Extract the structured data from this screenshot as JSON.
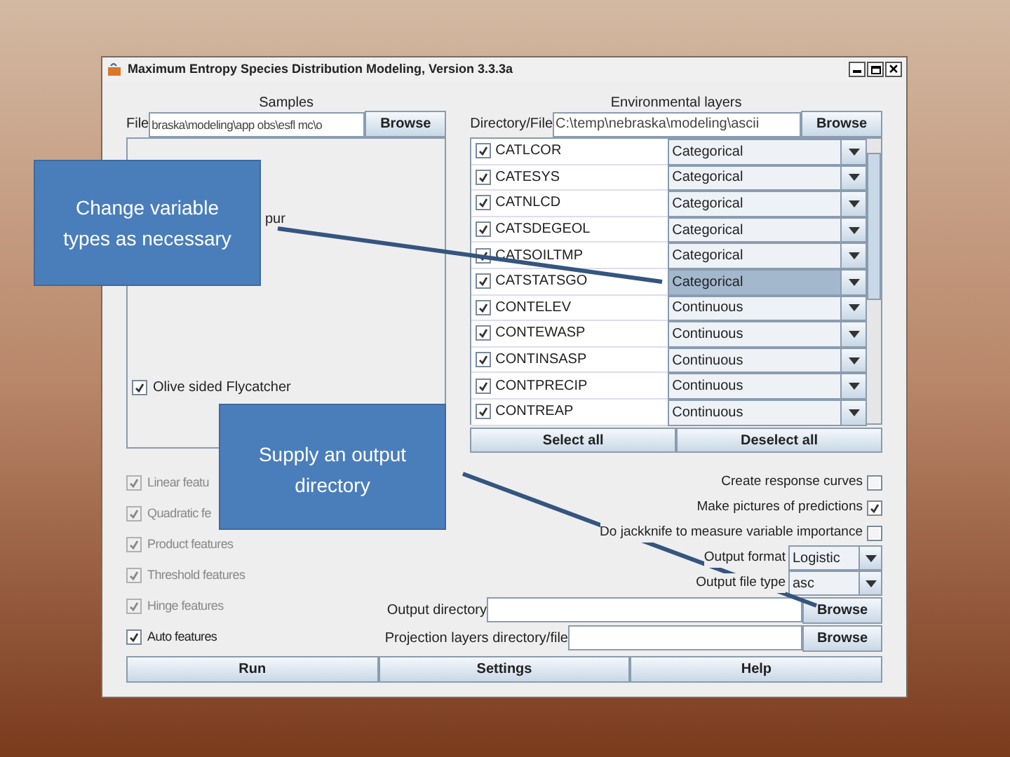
{
  "window": {
    "title": "Maximum Entropy Species Distribution Modeling, Version 3.3.3a"
  },
  "samples": {
    "heading": "Samples",
    "file_label": "File",
    "file_value": "braska\\modeling\\app  obs\\esfl  mc\\o",
    "browse": "Browse",
    "species": [
      {
        "label": "pur",
        "kind": "partial"
      },
      {
        "label": "Olive sided  Flycatcher",
        "kind": "species",
        "checked": true
      }
    ]
  },
  "environment": {
    "heading": "Environmental layers",
    "dir_label": "Directory/File",
    "dir_value": "C:\\temp\\nebraska\\modeling\\ascii",
    "browse": "Browse",
    "layers": [
      {
        "name": "CATLCOR",
        "checked": true,
        "type": "Categorical",
        "selected": false
      },
      {
        "name": "CATESYS",
        "checked": true,
        "type": "Categorical",
        "selected": false
      },
      {
        "name": "CATNLCD",
        "checked": true,
        "type": "Categorical",
        "selected": false
      },
      {
        "name": "CATSDEGEOL",
        "checked": true,
        "type": "Categorical",
        "selected": false
      },
      {
        "name": "CATSOILTMP",
        "checked": true,
        "type": "Categorical",
        "selected": false
      },
      {
        "name": "CATSTATSGO",
        "checked": true,
        "type": "Categorical",
        "selected": true
      },
      {
        "name": "CONTELEV",
        "checked": true,
        "type": "Continuous",
        "selected": false
      },
      {
        "name": "CONTEWASP",
        "checked": true,
        "type": "Continuous",
        "selected": false
      },
      {
        "name": "CONTINSASP",
        "checked": true,
        "type": "Continuous",
        "selected": false
      },
      {
        "name": "CONTPRECIP",
        "checked": true,
        "type": "Continuous",
        "selected": false
      },
      {
        "name": "CONTREAP",
        "checked": true,
        "type": "Continuous",
        "selected": false
      }
    ],
    "select_all": "Select all",
    "deselect_all": "Deselect all"
  },
  "features": [
    {
      "label": "Linear featu",
      "checked": true,
      "disabled": true
    },
    {
      "label": "Quadratic fe",
      "checked": true,
      "disabled": true
    },
    {
      "label": "Product features",
      "checked": true,
      "disabled": true
    },
    {
      "label": "Threshold features",
      "checked": true,
      "disabled": true
    },
    {
      "label": "Hinge features",
      "checked": true,
      "disabled": true
    },
    {
      "label": "Auto features",
      "checked": true,
      "disabled": false
    }
  ],
  "options": [
    {
      "label": "Create response curves",
      "checked": false
    },
    {
      "label": "Make pictures of predictions",
      "checked": true
    },
    {
      "label": "Do jackknife to measure variable importance",
      "checked": false
    }
  ],
  "selects": [
    {
      "label": "Output format",
      "value": "Logistic"
    },
    {
      "label": "Output file type",
      "value": "asc"
    }
  ],
  "paths": [
    {
      "label": "Output directory",
      "browse": "Browse"
    },
    {
      "label": "Projection layers directory/file",
      "browse": "Browse"
    }
  ],
  "buttons": [
    "Run",
    "Settings",
    "Help"
  ],
  "callouts": [
    {
      "text": "Change variable types as necessary"
    },
    {
      "text": "Supply  an output directory"
    }
  ]
}
